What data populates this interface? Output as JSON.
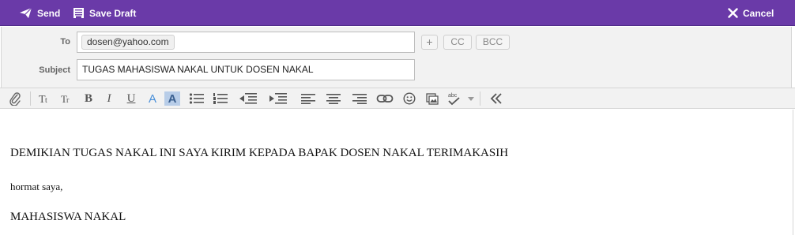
{
  "toolbar": {
    "send_label": "Send",
    "save_draft_label": "Save Draft",
    "cancel_label": "Cancel"
  },
  "header": {
    "to_label": "To",
    "to_recipient": "dosen@yahoo.com",
    "plus_label": "+",
    "cc_label": "CC",
    "bcc_label": "BCC",
    "subject_label": "Subject",
    "subject_value": "TUGAS MAHASISWA NAKAL UNTUK DOSEN NAKAL"
  },
  "format_toolbar": {
    "items": [
      "attach",
      "font-size",
      "font-face",
      "bold",
      "italic",
      "underline",
      "text-color",
      "highlight-color",
      "bullet-list",
      "numbered-list",
      "outdent",
      "indent",
      "align-left",
      "align-center",
      "align-right",
      "link",
      "emoticon",
      "insert-image",
      "spell-check",
      "collapse"
    ],
    "bold_glyph": "B",
    "italic_glyph": "I",
    "underline_glyph": "U",
    "color_glyph": "A",
    "highlight_glyph": "A",
    "spell_glyph": "abc",
    "collapse_glyph": "«"
  },
  "body": {
    "line1": "DEMIKIAN TUGAS NAKAL INI SAYA KIRIM KEPADA BAPAK DOSEN NAKAL TERIMAKASIH",
    "line2": "hormat saya,",
    "line3": "MAHASISWA NAKAL"
  },
  "colors": {
    "topbar": "#6a3aa8",
    "accent_text_color": "#4a90d9",
    "highlight_bg": "#b8cde8"
  }
}
